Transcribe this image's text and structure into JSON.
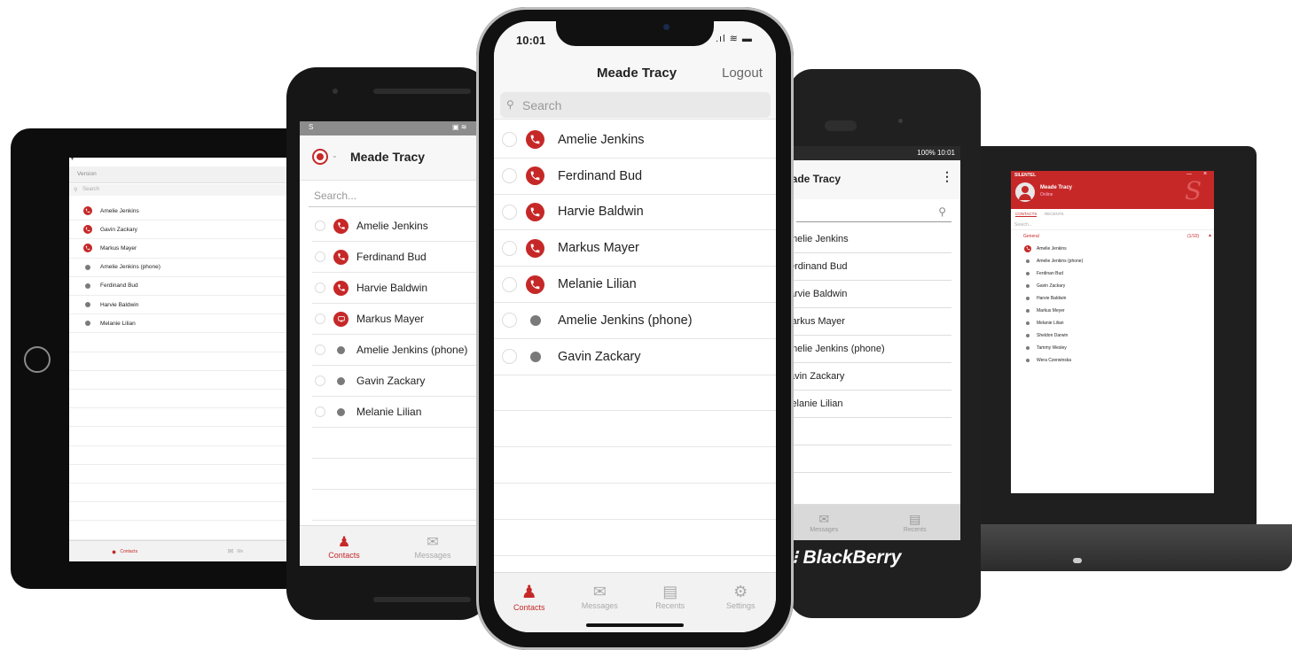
{
  "iphone": {
    "time": "10:01",
    "title": "Meade Tracy",
    "logout_label": "Logout",
    "search_placeholder": "Search",
    "contacts": [
      {
        "name": "Amelie Jenkins",
        "status": "phone"
      },
      {
        "name": "Ferdinand Bud",
        "status": "phone"
      },
      {
        "name": "Harvie Baldwin",
        "status": "phone"
      },
      {
        "name": "Markus Mayer",
        "status": "phone"
      },
      {
        "name": "Melanie Lilian",
        "status": "phone"
      },
      {
        "name": "Amelie Jenkins (phone)",
        "status": "offline"
      },
      {
        "name": "Gavin Zackary",
        "status": "offline"
      }
    ],
    "tabs": [
      "Contacts",
      "Messages",
      "Recents",
      "Settings"
    ]
  },
  "android": {
    "status_left": "S",
    "title": "Meade Tracy",
    "search_placeholder": "Search...",
    "contacts": [
      {
        "name": "Amelie Jenkins",
        "status": "phone"
      },
      {
        "name": "Ferdinand Bud",
        "status": "phone"
      },
      {
        "name": "Harvie Baldwin",
        "status": "phone"
      },
      {
        "name": "Markus Mayer",
        "status": "video"
      },
      {
        "name": "Amelie Jenkins (phone)",
        "status": "offline"
      },
      {
        "name": "Gavin Zackary",
        "status": "offline"
      },
      {
        "name": "Melanie Lilian",
        "status": "offline"
      }
    ],
    "tabs": [
      "Contacts",
      "Messages"
    ]
  },
  "tablet": {
    "header": "Version",
    "search_placeholder": "Search",
    "contacts": [
      {
        "name": "Amelie Jenkins",
        "status": "phone"
      },
      {
        "name": "Gavin Zackary",
        "status": "phone"
      },
      {
        "name": "Markus Mayer",
        "status": "phone"
      },
      {
        "name": "Amelie Jenkins (phone)",
        "status": "offline"
      },
      {
        "name": "Ferdinand Bud",
        "status": "offline"
      },
      {
        "name": "Harvie Baldwin",
        "status": "offline"
      },
      {
        "name": "Melanie Lilian",
        "status": "offline"
      }
    ],
    "tabs": [
      "Contacts",
      "Me"
    ]
  },
  "blackberry": {
    "status": "100%  10:01",
    "title": "eade Tracy",
    "contacts": [
      "melie Jenkins",
      "erdinand Bud",
      "arvie Baldwin",
      "larkus Mayer",
      "melie Jenkins (phone)",
      "avin Zackary",
      "lelanie Lilian"
    ],
    "tabs": [
      "Messages",
      "Recents"
    ],
    "brand": "BlackBerry"
  },
  "laptop": {
    "app_name": "SILENTEL",
    "user_name": "Meade Tracy",
    "user_status": "Online",
    "tabs": [
      "CONTACTS",
      "RECENTS"
    ],
    "search_placeholder": "Search...",
    "group_name": "General",
    "group_count": "(1/10)",
    "contacts": [
      {
        "name": "Amelie Jenkins",
        "status": "phone"
      },
      {
        "name": "Amelie Jenkins (phone)",
        "status": "offline"
      },
      {
        "name": "Ferdinan Bud",
        "status": "offline"
      },
      {
        "name": "Gavin Zackary",
        "status": "offline"
      },
      {
        "name": "Harvie Baldwin",
        "status": "offline"
      },
      {
        "name": "Markus Meyer",
        "status": "offline"
      },
      {
        "name": "Melanie Lilian",
        "status": "offline"
      },
      {
        "name": "Sheldon Darwin",
        "status": "offline"
      },
      {
        "name": "Tammy Wesley",
        "status": "offline"
      },
      {
        "name": "Wera Czerwinska",
        "status": "offline"
      }
    ]
  },
  "colors": {
    "accent": "#c62828",
    "tabbar": "#f2f2f2",
    "offline_dot": "#7a7a7a"
  }
}
